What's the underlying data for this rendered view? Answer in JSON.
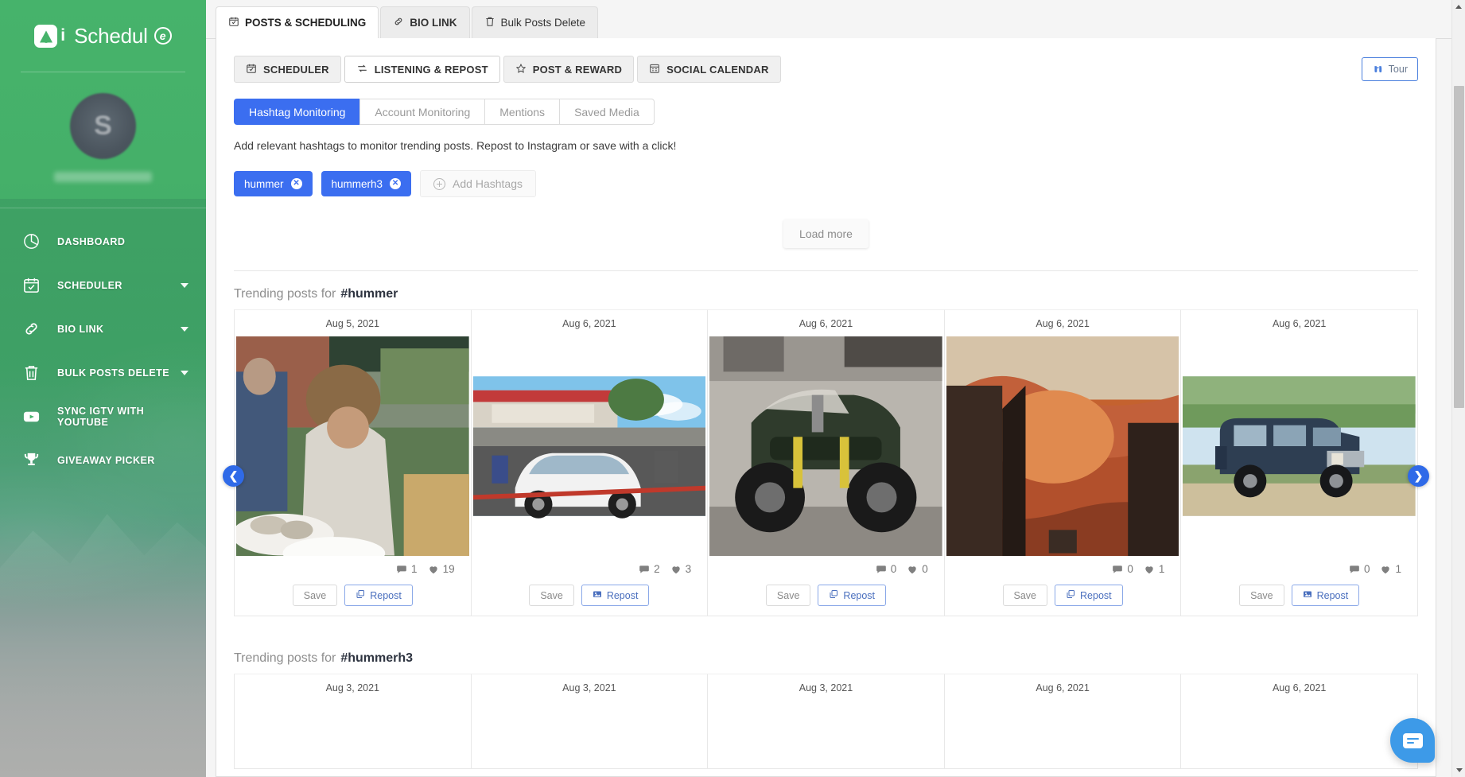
{
  "brand": {
    "name_i": "i",
    "name": "Schedul",
    "name_e": "e"
  },
  "sidebar": {
    "avatar_letter": "S",
    "items": [
      {
        "label": "DASHBOARD",
        "icon": "pie-chart-icon",
        "caret": false
      },
      {
        "label": "SCHEDULER",
        "icon": "calendar-check-icon",
        "caret": true
      },
      {
        "label": "BIO LINK",
        "icon": "link-icon",
        "caret": true
      },
      {
        "label": "BULK POSTS DELETE",
        "icon": "trash-icon",
        "caret": true
      },
      {
        "label": "SYNC IGTV WITH YOUTUBE",
        "icon": "youtube-icon",
        "caret": false
      },
      {
        "label": "GIVEAWAY PICKER",
        "icon": "trophy-icon",
        "caret": false
      }
    ]
  },
  "top_tabs": [
    {
      "label": "POSTS & SCHEDULING",
      "icon": "calendar-check-icon",
      "active": true
    },
    {
      "label": "BIO LINK",
      "icon": "link-icon",
      "active": false
    },
    {
      "label": "Bulk Posts Delete",
      "icon": "trash-icon",
      "active": false
    }
  ],
  "sub_tabs": [
    {
      "label": "SCHEDULER",
      "icon": "calendar-check-icon",
      "active": false
    },
    {
      "label": "LISTENING & REPOST",
      "icon": "repost-icon",
      "active": true
    },
    {
      "label": "POST & REWARD",
      "icon": "star-icon",
      "active": false
    },
    {
      "label": "SOCIAL CALENDAR",
      "icon": "calendar-icon",
      "active": false
    }
  ],
  "tour": {
    "label": "Tour",
    "icon": "binoculars-icon"
  },
  "pills": [
    {
      "label": "Hashtag Monitoring",
      "active": true
    },
    {
      "label": "Account Monitoring",
      "active": false
    },
    {
      "label": "Mentions",
      "active": false
    },
    {
      "label": "Saved Media",
      "active": false
    }
  ],
  "hint": "Add relevant hashtags to monitor trending posts. Repost to Instagram or save with a click!",
  "hashtags": [
    {
      "label": "hummer"
    },
    {
      "label": "hummerh3"
    }
  ],
  "add_hashtags": {
    "label": "Add Hashtags",
    "icon": "plus-circle-icon"
  },
  "load_more": {
    "label": "Load more"
  },
  "sections": [
    {
      "title_prefix": "Trending posts for",
      "hashtag": "#hummer",
      "cards": [
        {
          "date": "Aug 5, 2021",
          "comments": "1",
          "likes": "19",
          "save_label": "Save",
          "repost_label": "Repost",
          "repost_icon": "copy-icon",
          "image": "man-shucking-oysters-market"
        },
        {
          "date": "Aug 6, 2021",
          "comments": "2",
          "likes": "3",
          "save_label": "Save",
          "repost_label": "Repost",
          "repost_icon": "photo-icon",
          "image": "white-audi-suv-dealership"
        },
        {
          "date": "Aug 6, 2021",
          "comments": "0",
          "likes": "0",
          "save_label": "Save",
          "repost_label": "Repost",
          "repost_icon": "copy-icon",
          "image": "green-atv-quad-bike"
        },
        {
          "date": "Aug 6, 2021",
          "comments": "0",
          "likes": "1",
          "save_label": "Save",
          "repost_label": "Repost",
          "repost_icon": "copy-icon",
          "image": "red-rock-offroad-trail"
        },
        {
          "date": "Aug 6, 2021",
          "comments": "0",
          "likes": "1",
          "save_label": "Save",
          "repost_label": "Repost",
          "repost_icon": "photo-icon",
          "image": "blue-hummer-h3-grass"
        }
      ]
    },
    {
      "title_prefix": "Trending posts for",
      "hashtag": "#hummerh3",
      "cards": [
        {
          "date": "Aug 3, 2021"
        },
        {
          "date": "Aug 3, 2021"
        },
        {
          "date": "Aug 3, 2021"
        },
        {
          "date": "Aug 6, 2021"
        },
        {
          "date": "Aug 6, 2021"
        }
      ]
    }
  ],
  "carousel": {
    "prev_icon": "chevron-left-icon",
    "next_icon": "chevron-right-icon"
  },
  "chat": {
    "icon": "chat-bubble-icon"
  },
  "colors": {
    "brand_green": "#46b36b",
    "accent_blue": "#3b6ef0",
    "repost_blue": "#4a6fbe",
    "chat_blue": "#3d9ae8"
  }
}
